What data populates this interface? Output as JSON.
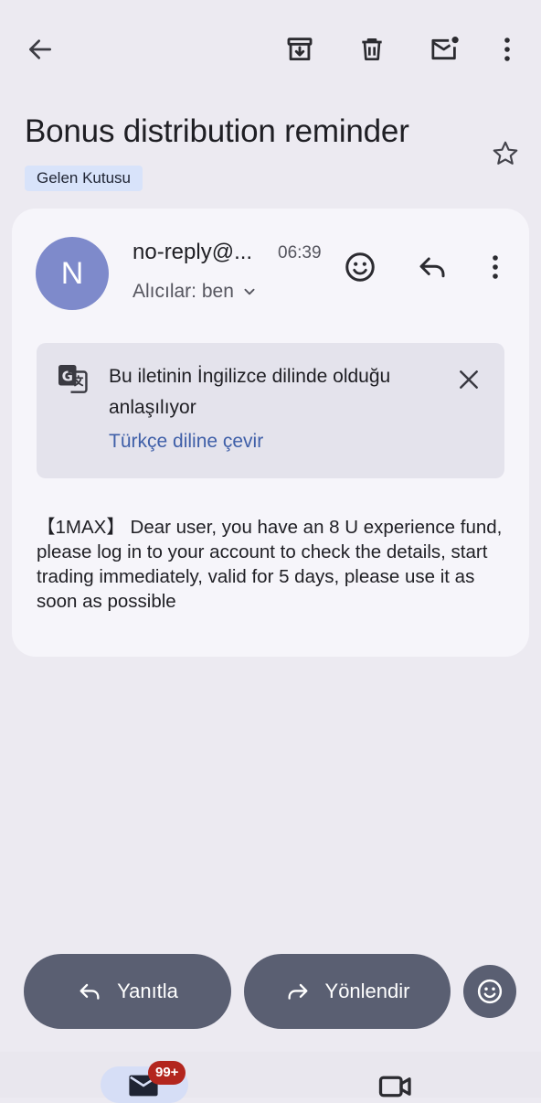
{
  "toolbar": {
    "back_icon": "arrow-left-icon",
    "archive_icon": "archive-icon",
    "delete_icon": "trash-icon",
    "mark_unread_icon": "mail-unread-icon",
    "more_icon": "more-vertical-icon"
  },
  "email": {
    "subject": "Bonus distribution reminder",
    "label": "Gelen Kutusu",
    "star_icon": "star-outline-icon"
  },
  "message": {
    "avatar_letter": "N",
    "avatar_color": "#7e8acb",
    "sender": "no-reply@...",
    "time": "06:39",
    "recipients": "Alıcılar: ben",
    "body": "【1MAX】 Dear user, you have an 8 U experience fund, please log in to your account to check the details, start trading immediately, valid for 5 days, please use it as soon as possible"
  },
  "translate": {
    "message": "Bu iletinin İngilizce dilinde olduğu anlaşılıyor",
    "action": "Türkçe diline çevir",
    "icon": "translate-icon",
    "close_icon": "close-icon"
  },
  "actions": {
    "reply_label": "Yanıtla",
    "forward_label": "Yönlendir",
    "emoji_icon": "emoji-icon"
  },
  "nav": {
    "mail_badge": "99+",
    "mail_icon": "mail-icon",
    "meet_icon": "video-icon"
  },
  "colors": {
    "background": "#eceaf1",
    "card": "#f6f5fa",
    "link": "#3f5fa8",
    "pill": "#5a5f72",
    "badge": "#b3261e"
  }
}
